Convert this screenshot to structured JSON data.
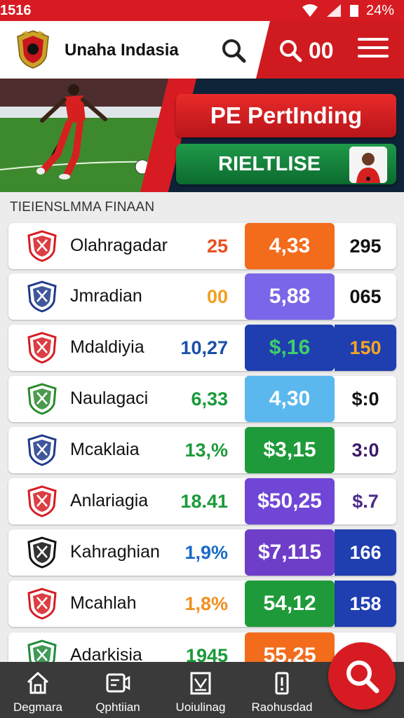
{
  "status_bar": {
    "time": "1516",
    "battery": "24%"
  },
  "header": {
    "title": "Unaha Indasia",
    "count": "00"
  },
  "hero": {
    "primary_button": "PE PertInding",
    "secondary_button": "RIELTLISE"
  },
  "section": {
    "title": "TIEIENSLMMA FINAAN"
  },
  "teams": [
    {
      "name": "Olahragadar",
      "stat": "25",
      "stat_color": "#e8501f",
      "value": "4,33",
      "value_bg": "#f26c1c",
      "value_color": "#ffffff",
      "extra": "295",
      "extra_bg": "#ffffff",
      "extra_color": "#111111"
    },
    {
      "name": "Jmradian",
      "stat": "00",
      "stat_color": "#f0a020",
      "value": "5,88",
      "value_bg": "#7a66e8",
      "value_color": "#ffffff",
      "extra": "065",
      "extra_bg": "#ffffff",
      "extra_color": "#111111"
    },
    {
      "name": "Mdaldiyia",
      "stat": "10,27",
      "stat_color": "#1a50a8",
      "value": "$,16",
      "value_bg": "#1f3eb0",
      "value_color": "#3fcf6a",
      "extra": "150",
      "extra_bg": "#1f3eb0",
      "extra_color": "#f5a623"
    },
    {
      "name": "Naulagaci",
      "stat": "6,33",
      "stat_color": "#1a9a3a",
      "value": "4,30",
      "value_bg": "#5ab8ee",
      "value_color": "#ffffff",
      "extra": "$:0",
      "extra_bg": "#ffffff",
      "extra_color": "#111111"
    },
    {
      "name": "Mcaklaia",
      "stat": "13,%",
      "stat_color": "#1a9a3a",
      "value": "$3,15",
      "value_bg": "#1f9a3a",
      "value_color": "#ffffff",
      "extra": "3:0",
      "extra_bg": "#ffffff",
      "extra_color": "#3a1a6a"
    },
    {
      "name": "Anlariagia",
      "stat": "18.41",
      "stat_color": "#1a9a3a",
      "value": "$50,25",
      "value_bg": "#7046d6",
      "value_color": "#ffffff",
      "extra": "$.7",
      "extra_bg": "#ffffff",
      "extra_color": "#4a2a8a"
    },
    {
      "name": "Kahraghian",
      "stat": "1,9%",
      "stat_color": "#1a6ac8",
      "value": "$7,115",
      "value_bg": "#6e3ec9",
      "value_color": "#ffffff",
      "extra": "166",
      "extra_bg": "#1f3eb0",
      "extra_color": "#ffffff"
    },
    {
      "name": "Mcahlah",
      "stat": "1,8%",
      "stat_color": "#f09020",
      "value": "54,12",
      "value_bg": "#1f9a3a",
      "value_color": "#ffffff",
      "extra": "158",
      "extra_bg": "#1f3eb0",
      "extra_color": "#ffffff"
    },
    {
      "name": "Adarkisia",
      "stat": "1945",
      "stat_color": "#1a9a3a",
      "value": "55.25",
      "value_bg": "#f26c1c",
      "value_color": "#ffffff",
      "extra": "",
      "extra_bg": "#ffffff",
      "extra_color": "#111111"
    }
  ],
  "bottom_nav": {
    "items": [
      {
        "label": "Degmara",
        "icon": "home-icon"
      },
      {
        "label": "Qphtiian",
        "icon": "video-icon"
      },
      {
        "label": "Uoiulinag",
        "icon": "calendar-icon"
      },
      {
        "label": "Raohusdad",
        "icon": "trophy-icon"
      }
    ]
  },
  "colors": {
    "brand_red": "#d61c22",
    "nav_bg": "#3a3a3a"
  }
}
